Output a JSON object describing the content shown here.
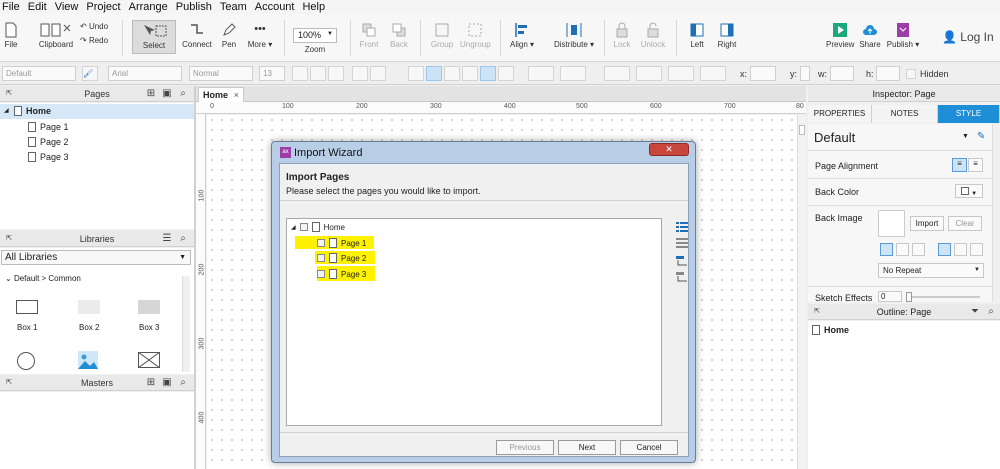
{
  "menu": [
    "File",
    "Edit",
    "View",
    "Project",
    "Arrange",
    "Publish",
    "Team",
    "Account",
    "Help"
  ],
  "toolbar": {
    "file": "File",
    "clipboard": "Clipboard",
    "undo": "Undo",
    "redo": "Redo",
    "select": "Select",
    "connect": "Connect",
    "pen": "Pen",
    "more": "More ▾",
    "zoom_value": "100%",
    "zoom": "Zoom",
    "front": "Front",
    "back": "Back",
    "group": "Group",
    "ungroup": "Ungroup",
    "align": "Align ▾",
    "distribute": "Distribute ▾",
    "lock": "Lock",
    "unlock": "Unlock",
    "left": "Left",
    "right": "Right",
    "preview": "Preview",
    "share": "Share",
    "publish": "Publish ▾",
    "login": "Log In"
  },
  "formatbar": {
    "style": "Default",
    "font": "Arial",
    "weight": "Normal",
    "size": "13",
    "x": "x:",
    "y": "y:",
    "w": "w:",
    "h": "h:",
    "hidden": "Hidden"
  },
  "pages_panel": {
    "title": "Pages",
    "home": "Home",
    "children": [
      "Page 1",
      "Page 2",
      "Page 3"
    ]
  },
  "libraries_panel": {
    "title": "Libraries",
    "dropdown": "All Libraries",
    "group": "Default > Common",
    "items": [
      "Box 1",
      "Box 2",
      "Box 3"
    ]
  },
  "masters_panel": {
    "title": "Masters"
  },
  "canvas": {
    "tab": "Home",
    "ruler_top": [
      "0",
      "100",
      "200",
      "300",
      "400",
      "500",
      "600",
      "700",
      "80"
    ],
    "ruler_left": [
      "100",
      "200",
      "300",
      "400"
    ]
  },
  "inspector": {
    "title": "Inspector: Page",
    "tabs": [
      "PROPERTIES",
      "NOTES",
      "STYLE"
    ],
    "style_name": "Default",
    "page_alignment": "Page Alignment",
    "back_color": "Back Color",
    "back_image": "Back Image",
    "import": "Import",
    "clear": "Clear",
    "repeat": "No Repeat",
    "sketch_effects": "Sketch Effects",
    "sketch_value": "0"
  },
  "outline": {
    "title": "Outline: Page",
    "home": "Home"
  },
  "dialog": {
    "title": "Import Wizard",
    "heading": "Import Pages",
    "instructions": "Please select the pages you would like to import.",
    "root": "Home",
    "pages": [
      "Page 1",
      "Page 2",
      "Page 3"
    ],
    "previous": "Previous",
    "next": "Next",
    "cancel": "Cancel",
    "highlight_color": "#fff200"
  }
}
